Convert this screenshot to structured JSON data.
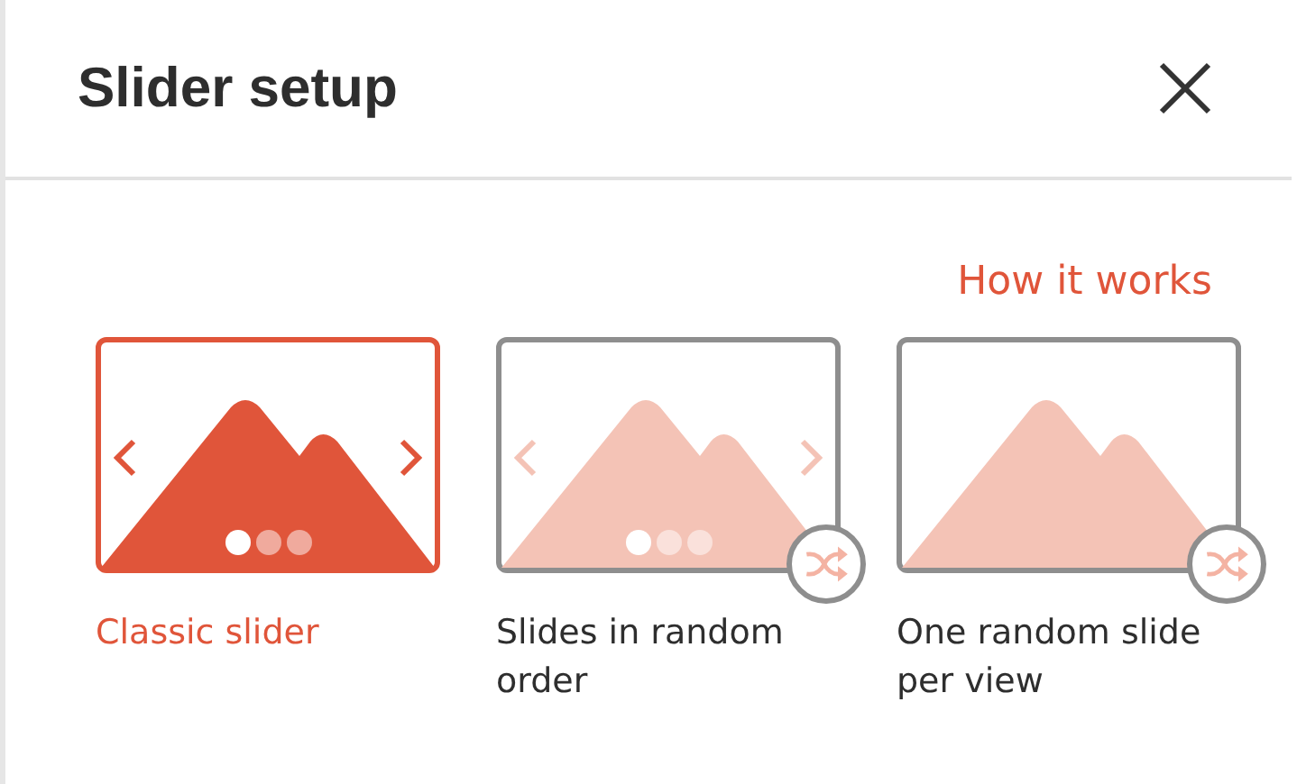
{
  "dialog": {
    "title": "Slider setup"
  },
  "help_link": "How it works",
  "options": [
    {
      "label": "Classic slider",
      "kind": "classic",
      "selected": true
    },
    {
      "label": "Slides in random order",
      "kind": "random-order",
      "selected": false
    },
    {
      "label": "One random slide per view",
      "kind": "random-single",
      "selected": false
    }
  ]
}
